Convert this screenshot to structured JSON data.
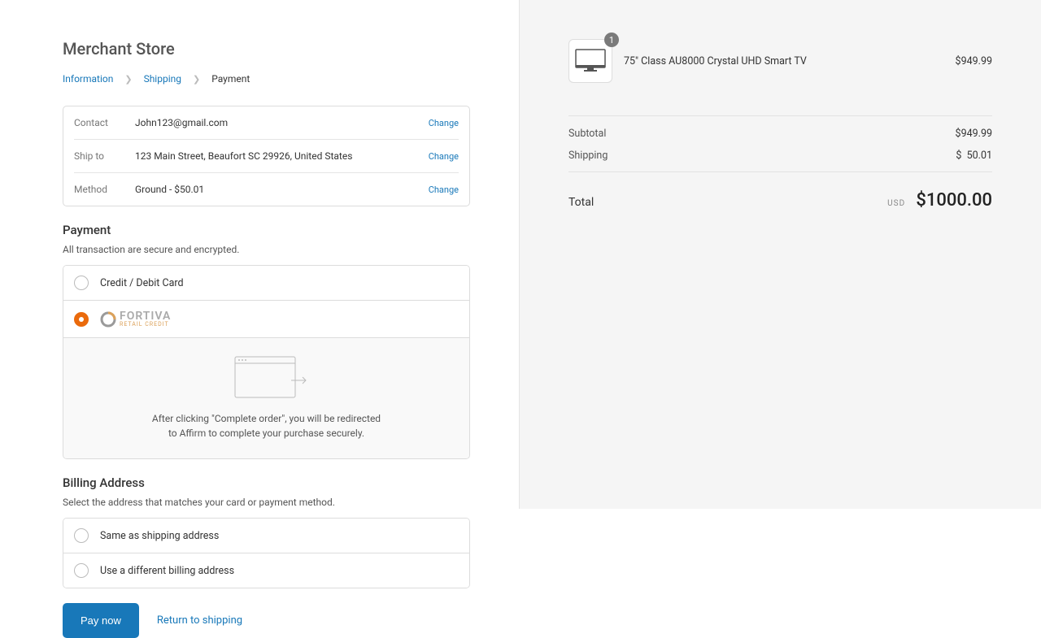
{
  "store": {
    "name": "Merchant Store"
  },
  "breadcrumb": {
    "information": "Information",
    "shipping": "Shipping",
    "payment": "Payment"
  },
  "review": {
    "contact": {
      "label": "Contact",
      "value": "John123@gmail.com",
      "change": "Change"
    },
    "ship_to": {
      "label": "Ship to",
      "value": "123 Main Street, Beaufort SC 29926, United States",
      "change": "Change"
    },
    "method": {
      "label": "Method",
      "value": "Ground - $50.01",
      "change": "Change"
    }
  },
  "payment": {
    "heading": "Payment",
    "sub": "All transaction are secure and encrypted.",
    "options": {
      "card": "Credit / Debit Card",
      "fortiva_brand": "FORTIVA",
      "fortiva_sub": "RETAIL CREDIT"
    },
    "redirect_line1": "After clicking \"Complete order\", you will be redirected",
    "redirect_line2": "to Affirm to complete your purchase securely."
  },
  "billing": {
    "heading": "Billing Address",
    "sub": "Select the address that matches your card or payment method.",
    "same": "Same as shipping address",
    "diff": "Use a different billing address"
  },
  "actions": {
    "pay": "Pay now",
    "return": "Return to shipping"
  },
  "cart": {
    "item": {
      "qty": "1",
      "name": "75\" Class AU8000 Crystal UHD Smart TV",
      "price": "$949.99"
    },
    "subtotal": {
      "label": "Subtotal",
      "value": "$949.99"
    },
    "shipping": {
      "label": "Shipping",
      "currency": "$",
      "value": "50.01"
    },
    "total": {
      "label": "Total",
      "currency": "USD",
      "value": "$1000.00"
    }
  }
}
